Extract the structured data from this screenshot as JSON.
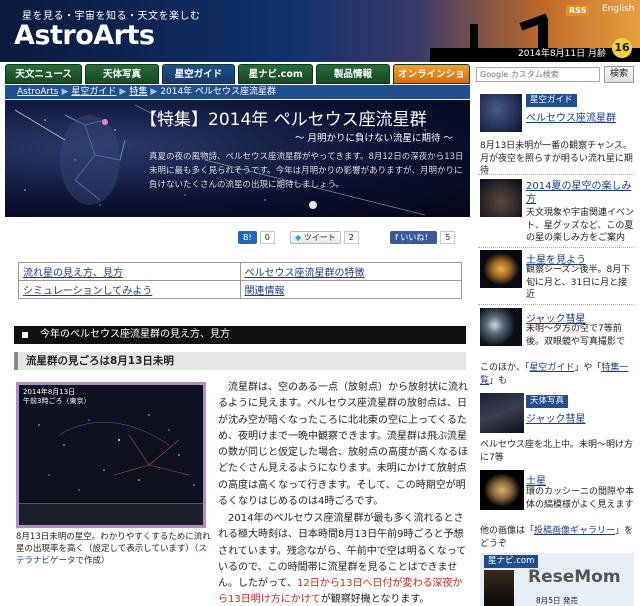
{
  "header": {
    "tagline": "星を見る・宇宙を知る・天文を楽しむ",
    "logo": "AstroArts",
    "rss": "RSS",
    "lang": "English",
    "date": "2014年8月11日 月齢",
    "moon_age": "16"
  },
  "nav": {
    "tabs": [
      "天文ニュース",
      "天体写真",
      "星空ガイド",
      "星ナビ.com",
      "製品情報",
      "オンラインショップ"
    ]
  },
  "search": {
    "placeholder": "Google カスタム検索",
    "button": "検索"
  },
  "breadcrumb": {
    "items": [
      "AstroArts",
      "星空ガイド",
      "特集",
      "2014年 ペルセウス座流星群"
    ]
  },
  "hero": {
    "title": "【特集】2014年 ペルセウス座流星群",
    "subtitle": "～ 月明かりに負けない流星に期待 ～",
    "text": "真夏の夜の風物詩、ペルセウス座流星群がやってきます。8月12日の深夜から13日未明に最も多く見られそうです。今年は月明かりの影響がありますが、月明かりに負けないたくさんの流星の出現に期待しましょう。"
  },
  "social": {
    "bookmark": "B!",
    "bookmark_count": "0",
    "tweet": "ツイート",
    "tweet_count": "2",
    "like": "いいね！",
    "like_count": "5"
  },
  "toc": {
    "items": [
      "流れ星の見え方、見方",
      "ペルセウス座流星群の特徴",
      "シミュレーションしてみよう",
      "関連情報"
    ]
  },
  "section": {
    "title": "今年のペルセウス座流星群の見え方、見方",
    "subtitle": "流星群の見ごろは8月13日未明"
  },
  "starmap": {
    "date_line1": "2014年8月13日",
    "date_line2": "午前3時ごろ（東京）",
    "caption_pre": "8月13日未明の星空。わかりやすくするために流れ星の出現率を高く（設定して表示しています）（",
    "caption_link": "ステラナビゲータ",
    "caption_post": "で作成）"
  },
  "body": {
    "para1": "流星群は、空のある一点（放射点）から放射状に流れるように見えます。ペルセウス座流星群の放射点は、日が沈み空が暗くなったころに北北東の空に上ってくるため、夜明けまで一晩中観察できます。流星群は飛ぶ流星の数が同じと仮定した場合、放射点の高度が高くなるほどたくさん見えるようになります。未明にかけて放射点の高度は高くなって行きます。そして、この時期空が明るくなりはじめるのは4時ごろです。",
    "para2_a": "2014年のペルセウス座流星群が最も多く流れるとされる極大時刻は、日本時間8月13日午前9時ごろと予想されています。残念ながら、午前中で空は明るくなっているので、この時間帯に流星群を見ることはできません。したがって、",
    "para2_red": "12日から13日へ日付が変わる深夜から13日明け方にかけて",
    "para2_b": "が観察好機となります。"
  },
  "sidebar": {
    "guide_label": "星空ガイド",
    "guide_link": "ペルセウス座流星群",
    "guide_desc": "8月13日未明が一番の観察チャンス。月が夜空を照らすが明るい流れ星に期待",
    "item2_link": "2014夏の星空の楽しみ方",
    "item2_desc": "天文現象や宇宙関連イベント、星グッズなど、この夏の星の楽しみ方をご案内",
    "item3_link": "土星を見よう",
    "item3_desc": "観察シーズン後半。8月下旬に月と、31日に月と接近",
    "item4_link": "ジャック彗星",
    "item4_desc": "未明～夕方の空で7等前後。双眼鏡や写真撮影で",
    "more_pre": "このほか、「",
    "more_link1": "星空ガイド",
    "more_mid": "」や「",
    "more_link2": "特集一覧",
    "more_post": "」も",
    "photo_label": "天体写真",
    "photo_link": "ジャック彗星",
    "photo_desc": "ペルセウス座を北上中。未明～明け方に7等",
    "saturn_link": "土星",
    "saturn_desc": "環のカッシーニの間隙や本体の縞模様がよく見えます",
    "gallery_pre": "他の画像は「",
    "gallery_link": "投稿画像ギャラリー",
    "gallery_post": "」をどうぞ",
    "mag_label": "星ナビ.com",
    "mag_date": "8月5日 発売"
  },
  "watermark": "ReseMom"
}
